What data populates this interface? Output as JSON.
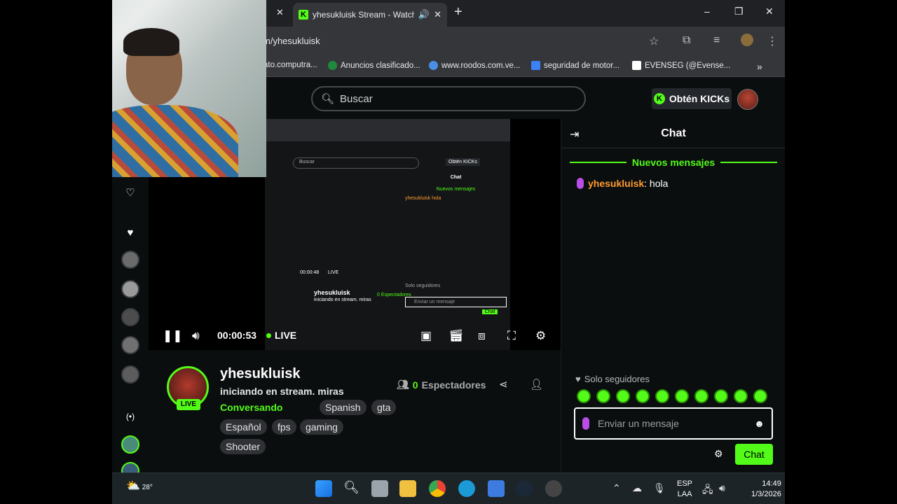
{
  "browser": {
    "tab_title": "yhesukluisk Stream - Watch",
    "address": "m/yhesukluisk",
    "bookmarks": [
      "ato.computra...",
      "Anuncios clasificado...",
      "www.roodos.com.ve...",
      "seguridad de motor...",
      "EVENSEG (@Evense..."
    ],
    "bookmarks_more": "»",
    "window_controls": [
      "–",
      "❐",
      "✕"
    ]
  },
  "kick_header": {
    "search_placeholder": "Buscar",
    "kicks_button": "Obtén KICKs"
  },
  "player": {
    "time": "00:00:53",
    "live_label": "LIVE",
    "controls": [
      "pause",
      "volume",
      "theater",
      "pip",
      "cast",
      "fullscreen",
      "settings"
    ]
  },
  "channel": {
    "name": "yhesukluisk",
    "live_badge": "LIVE",
    "title": "iniciando en stream. miras",
    "category": "Conversando",
    "tags_row1": [
      "Spanish",
      "gta"
    ],
    "tags_row2": [
      "Español",
      "fps",
      "gaming"
    ],
    "tags_row3": [
      "Shooter"
    ],
    "viewers_count": "0",
    "viewers_label": "Espectadores"
  },
  "chat": {
    "title": "Chat",
    "new_messages": "Nuevos mensajes",
    "messages": [
      {
        "user": "yhesukluisk",
        "text": ": hola"
      }
    ],
    "followers_only": "Solo seguidores",
    "input_placeholder": "Enviar un mensaje",
    "send_button": "Chat"
  },
  "nested_preview": {
    "search": "Buscar",
    "kicks": "Obtén KICKs",
    "chat_title": "Chat",
    "new_messages": "Nuevos mensajes",
    "message": "yhesukluisk hola",
    "channel_name": "yhesukluisk",
    "title": "iniciando en stream. miras",
    "time": "00:00:48",
    "live": "LIVE",
    "viewers": "0 Espectadores",
    "followers": "Solo seguidores",
    "input": "Enviar un mensaje",
    "send": "Chat"
  },
  "taskbar": {
    "temperature": "28°",
    "language": "ESP",
    "layout": "LAA",
    "time": "14:49",
    "date": "1/3/2026"
  },
  "colors": {
    "kick_green": "#53fc18",
    "bg": "#0b0e0f",
    "username": "#ff9b2e",
    "mic": "#b84ee6"
  }
}
